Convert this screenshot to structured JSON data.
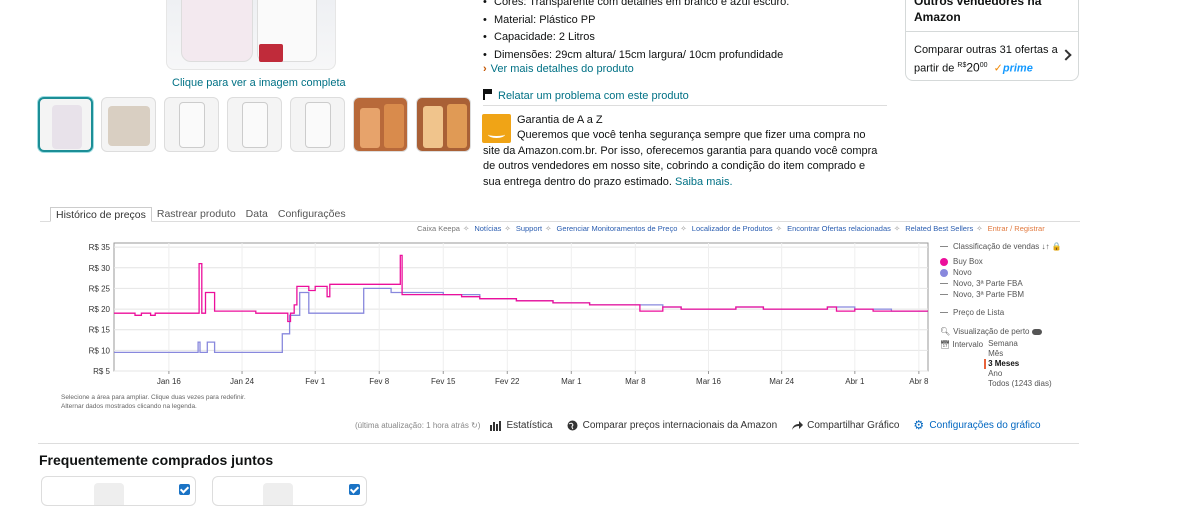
{
  "gallery": {
    "view_full_label": "Clique para ver a imagem completa"
  },
  "bullets": [
    "Cores: Transparente com detalhes em branco e azul escuro.",
    "Material: Plástico PP",
    "Capacidade: 2 Litros",
    "Dimensões: 29cm altura/ 15cm largura/ 10cm profundidade"
  ],
  "more_details": "Ver mais detalhes do produto",
  "report_problem": "Relatar um problema com este produto",
  "guarantee": {
    "title": "Garantia de A a Z",
    "text": "Queremos que você tenha segurança sempre que fizer uma compra no site da Amazon.com.br. Por isso, oferecemos garantia para quando você compra de outros vendedores em nosso site, cobrindo a condição do item comprado e sua entrega dentro do prazo estimado.",
    "learn_more": "Saiba mais."
  },
  "sidebox": {
    "title": "Outros vendedores na Amazon",
    "compare_line1": "Comparar outras 31 ofertas a",
    "compare_prefix": "partir de",
    "currency": "R$",
    "price_int": "20",
    "price_frac": "00",
    "prime": "prime"
  },
  "keepa": {
    "tabs": [
      "Histórico de preços",
      "Rastrear produto",
      "Data",
      "Configurações"
    ],
    "links": [
      "Caixa Keepa",
      "Notícias",
      "Support",
      "Gerenciar Monitoramentos de Preço",
      "Localizador de Produtos",
      "Encontrar Ofertas relacionadas",
      "Related Best Sellers"
    ],
    "register": "Entrar / Registrar",
    "notes": [
      "Selecione a área para ampliar. Clique duas vezes para redefinir.",
      "Alternar dados mostrados clicando na legenda."
    ],
    "legend": {
      "sales_rank": "Classificação de vendas",
      "buy_box": "Buy Box",
      "new": "Novo",
      "new_fba": "Novo, 3ª Parte FBA",
      "new_fbm": "Novo, 3ª Parte FBM",
      "list_price": "Preço de Lista",
      "close_view": "Visualização de perto",
      "interval": "Intervalo",
      "ranges": [
        "Semana",
        "Mês",
        "3 Meses",
        "Ano",
        "Todos (1243 dias)"
      ],
      "selected_range": "3 Meses"
    },
    "toolbar": {
      "updated": "(última atualização: 1 hora atrás",
      "stats": "Estatística",
      "compare": "Comparar preços internacionais da Amazon",
      "share": "Compartilhar Gráfico",
      "settings": "Configurações do gráfico"
    },
    "colors": {
      "buy_box": "#ec0f9b",
      "new": "#8888dd"
    }
  },
  "chart_data": {
    "type": "line",
    "y_tick_labels": [
      "R$ 5",
      "R$ 10",
      "R$ 15",
      "R$ 20",
      "R$ 25",
      "R$ 30",
      "R$ 35"
    ],
    "y_ticks": [
      5,
      10,
      15,
      20,
      25,
      30,
      35
    ],
    "ylim": [
      5,
      36
    ],
    "x_tick_labels": [
      "Jan 16",
      "Jan 24",
      "Fev 1",
      "Fev 8",
      "Fev 15",
      "Fev 22",
      "Mar 1",
      "Mar 8",
      "Mar 16",
      "Mar 24",
      "Abr 1",
      "Abr 8"
    ],
    "x_ticks": [
      6,
      14,
      22,
      29,
      36,
      43,
      50,
      57,
      65,
      73,
      81,
      88
    ],
    "xlim": [
      0,
      89
    ],
    "series": [
      {
        "name": "Buy Box",
        "color": "#ec0f9b",
        "points": [
          [
            0,
            19
          ],
          [
            2,
            19
          ],
          [
            2.3,
            18.5
          ],
          [
            3,
            19
          ],
          [
            4,
            18.5
          ],
          [
            4.5,
            19
          ],
          [
            6,
            19
          ],
          [
            9,
            19
          ],
          [
            9.3,
            31
          ],
          [
            9.6,
            19
          ],
          [
            10,
            24
          ],
          [
            11,
            24
          ],
          [
            11,
            19.5
          ],
          [
            15,
            19.5
          ],
          [
            15.5,
            19
          ],
          [
            18,
            19
          ],
          [
            18.5,
            19
          ],
          [
            19,
            17
          ],
          [
            19.3,
            19
          ],
          [
            19.7,
            21
          ],
          [
            20,
            25.5
          ],
          [
            21,
            25.5
          ],
          [
            21.3,
            24.5
          ],
          [
            22,
            25.5
          ],
          [
            23,
            25.5
          ],
          [
            23.3,
            23
          ],
          [
            23.6,
            26
          ],
          [
            25,
            26
          ],
          [
            26,
            26
          ],
          [
            29,
            26
          ],
          [
            30,
            26
          ],
          [
            31,
            26
          ],
          [
            31.3,
            33
          ],
          [
            31.5,
            23.5
          ],
          [
            35,
            23.5
          ],
          [
            38,
            23
          ],
          [
            40,
            22.5
          ],
          [
            44,
            22
          ],
          [
            48,
            21.5
          ],
          [
            50,
            21.5
          ],
          [
            52,
            21
          ],
          [
            56,
            21
          ],
          [
            57,
            21
          ],
          [
            57.5,
            19.5
          ],
          [
            59,
            19.5
          ],
          [
            60,
            20.5
          ],
          [
            61,
            20.5
          ],
          [
            62,
            20
          ],
          [
            66,
            20
          ],
          [
            68,
            20.5
          ],
          [
            70,
            20.5
          ],
          [
            71,
            20
          ],
          [
            75,
            20
          ],
          [
            78,
            20.5
          ],
          [
            79,
            19.5
          ],
          [
            81,
            20
          ],
          [
            83,
            19.5
          ],
          [
            85,
            19.5
          ],
          [
            88,
            19.5
          ],
          [
            89,
            19.5
          ]
        ]
      },
      {
        "name": "Novo",
        "color": "#8888dd",
        "points": [
          [
            0,
            9.5
          ],
          [
            9,
            9.5
          ],
          [
            9.2,
            12
          ],
          [
            9.4,
            9.5
          ],
          [
            10,
            9.5
          ],
          [
            10.2,
            12
          ],
          [
            10.6,
            12
          ],
          [
            11,
            9.5
          ],
          [
            18,
            9.5
          ],
          [
            18.4,
            14
          ],
          [
            19,
            14
          ],
          [
            19.2,
            18.5
          ],
          [
            20,
            18.5
          ],
          [
            20.3,
            24
          ],
          [
            21,
            24
          ],
          [
            21.3,
            19
          ],
          [
            25,
            19
          ],
          [
            27,
            19
          ],
          [
            27.3,
            25
          ],
          [
            30,
            25
          ],
          [
            30.3,
            24
          ],
          [
            33,
            24
          ],
          [
            36,
            23.5
          ],
          [
            40,
            22.5
          ],
          [
            44,
            22
          ],
          [
            48,
            21.5
          ],
          [
            50,
            21.5
          ],
          [
            52,
            21
          ],
          [
            57,
            21
          ],
          [
            60,
            20.5
          ],
          [
            62,
            20
          ],
          [
            66,
            20
          ],
          [
            68,
            20.5
          ],
          [
            71,
            20
          ],
          [
            75,
            20
          ],
          [
            78,
            20.5
          ],
          [
            81,
            20
          ],
          [
            85,
            19.5
          ],
          [
            89,
            19.5
          ]
        ]
      }
    ]
  },
  "frequently_bought": "Frequentemente comprados juntos"
}
